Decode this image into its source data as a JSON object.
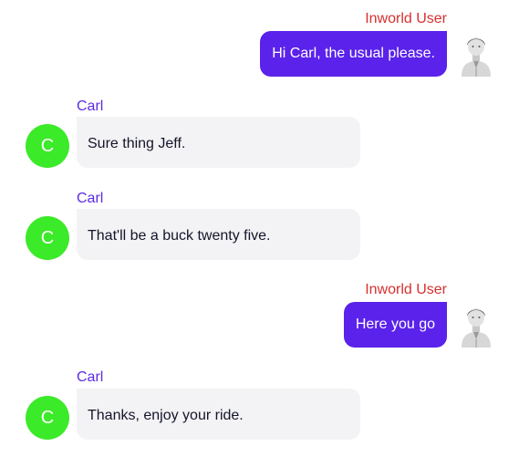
{
  "chat": {
    "user_name": "Inworld User",
    "bot_name": "Carl",
    "bot_initial": "C",
    "messages": [
      {
        "sender": "user",
        "text": "Hi Carl, the usual please."
      },
      {
        "sender": "bot",
        "text": "Sure thing Jeff."
      },
      {
        "sender": "bot",
        "text": "That'll be a buck twenty five."
      },
      {
        "sender": "user",
        "text": "Here you go"
      },
      {
        "sender": "bot",
        "text": "Thanks, enjoy your ride."
      }
    ]
  },
  "icons": {
    "user_avatar": "user-avatar-icon",
    "bot_avatar": "bot-avatar-icon"
  },
  "colors": {
    "user_bubble": "#5a22ea",
    "bot_bubble": "#f3f3f5",
    "user_name": "#d6312e",
    "bot_name": "#5b2be0",
    "bot_avatar": "#3bea28"
  }
}
